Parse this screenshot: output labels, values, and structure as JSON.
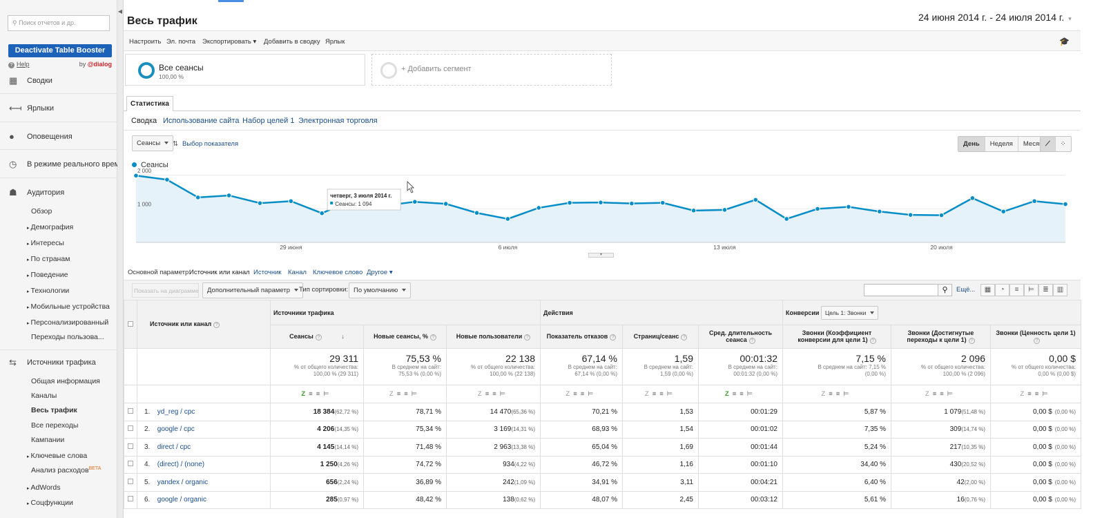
{
  "sidebar": {
    "search_placeholder": "Поиск отчетов и др.",
    "booster": "Deactivate Table Booster",
    "help": "Help",
    "by": "by",
    "brand": "@dialog",
    "nav": [
      {
        "icon": "grid-icon",
        "label": "Сводки"
      },
      {
        "icon": "tag-icon",
        "label": "Ярлыки"
      },
      {
        "icon": "bulb-icon",
        "label": "Оповещения"
      },
      {
        "icon": "clock-icon",
        "label": "В режиме реального врем"
      },
      {
        "icon": "people-icon",
        "label": "Аудитория"
      },
      {
        "icon": "arrows-icon",
        "label": "Источники трафика"
      }
    ],
    "audience_sub": [
      "Обзор",
      "Демография",
      "Интересы",
      "По странам",
      "Поведение",
      "Технологии",
      "Мобильные устройства",
      "Персонализированный",
      "Переходы пользова..."
    ],
    "traffic_sub": [
      "Общая информация",
      "Каналы",
      "Весь трафик",
      "Все переходы",
      "Кампании",
      "Ключевые слова",
      "Анализ расходов",
      "AdWords",
      "Соцфункции"
    ],
    "beta": "BETA"
  },
  "header": {
    "title": "Весь трафик",
    "date": "24 июня 2014 г. - 24 июля 2014 г.",
    "date_arrow": "▾"
  },
  "toolbar": {
    "items": [
      "Настроить",
      "Эл. почта",
      "Экспортировать ▾",
      "Добавить в сводку",
      "Ярлык"
    ],
    "hat": "🎓"
  },
  "segments": {
    "name": "Все сеансы",
    "pct": "100,00 %",
    "add": "+ Добавить сегмент"
  },
  "tabs": {
    "stat": "Статистика",
    "sub": [
      "Сводка",
      "Использование сайта",
      "Набор целей 1",
      "Электронная торговля"
    ]
  },
  "chart_controls": {
    "metric": "Сеансы",
    "pick": "Выбор показателя",
    "periods": [
      "День",
      "Неделя",
      "Месяц"
    ]
  },
  "chart_data": {
    "type": "area",
    "series": [
      {
        "name": "Сеансы",
        "values": [
          1990,
          1870,
          1340,
          1400,
          1170,
          1230,
          870,
          1280,
          1094,
          1210,
          1150,
          880,
          700,
          1030,
          1180,
          1190,
          1160,
          1180,
          950,
          970,
          1270,
          700,
          1000,
          1060,
          920,
          820,
          810,
          1320,
          920,
          1230,
          1140
        ]
      }
    ],
    "x_ticks": [
      "29 июня",
      "6 июля",
      "13 июля",
      "20 июля"
    ],
    "y_ticks": [
      "1 000",
      "2 000"
    ],
    "ylim": [
      0,
      2200
    ],
    "color": "#058dc7",
    "tooltip": {
      "date": "четверг, 3 июля 2014 г.",
      "value": "Сеансы: 1 094"
    }
  },
  "primary": {
    "label": "Основной параметр:",
    "current": "Источник или канал",
    "links": [
      "Источник",
      "Канал",
      "Ключевое слово",
      "Другое ▾"
    ]
  },
  "tablebar": {
    "plot": "Показать на диаграмме",
    "secondary": "Дополнительный параметр",
    "sort_label": "Тип сортировки:",
    "sort": "По умолчанию",
    "more": "Ещё..."
  },
  "table": {
    "groups": [
      "Источники трафика",
      "Действия",
      "Конверсии"
    ],
    "goal": "Цель 1: Звонки",
    "dim": "Источник или канал",
    "cols": [
      "Сеансы",
      "Новые сеансы, %",
      "Новые пользователи",
      "Показатель отказов",
      "Страниц/сеанс",
      "Сред. длительность сеанса",
      "Звонки (Коэффициент конверсии для цели 1)",
      "Звонки (Достигнутые переходы к цели 1)",
      "Звонки (Ценность цели 1)"
    ],
    "totals": [
      {
        "v": "29 311",
        "s1": "% от общего количества:",
        "s2": "100,00 % (29 311)"
      },
      {
        "v": "75,53 %",
        "s1": "В среднем на сайт:",
        "s2": "75,53 % (0,00 %)"
      },
      {
        "v": "22 138",
        "s1": "% от общего количества:",
        "s2": "100,00 % (22 138)"
      },
      {
        "v": "67,14 %",
        "s1": "В среднем на сайт:",
        "s2": "67,14 % (0,00 %)"
      },
      {
        "v": "1,59",
        "s1": "В среднем на сайт:",
        "s2": "1,59 (0,00 %)"
      },
      {
        "v": "00:01:32",
        "s1": "В среднем на сайт:",
        "s2": "00:01:32 (0,00 %)"
      },
      {
        "v": "7,15 %",
        "s1": "В среднем на сайт: 7,15 %",
        "s2": "(0,00 %)"
      },
      {
        "v": "2 096",
        "s1": "% от общего количества:",
        "s2": "100,00 % (2 096)"
      },
      {
        "v": "0,00 $",
        "s1": "% от общего количества:",
        "s2": "0,00 % (0,00 $)"
      }
    ],
    "rows": [
      {
        "n": "1.",
        "src": "yd_reg / cpc",
        "s": "18 384",
        "sp": "(62,72 %)",
        "ns": "78,71 %",
        "nu": "14 470",
        "nup": "(65,36 %)",
        "b": "70,21 %",
        "p": "1,53",
        "d": "00:01:29",
        "cr": "5,87 %",
        "g": "1 079",
        "gp": "(51,48 %)",
        "val": "0,00 $",
        "vp": "(0,00 %)"
      },
      {
        "n": "2.",
        "src": "google / cpc",
        "s": "4 206",
        "sp": "(14,35 %)",
        "ns": "75,34 %",
        "nu": "3 169",
        "nup": "(14,31 %)",
        "b": "68,93 %",
        "p": "1,54",
        "d": "00:01:02",
        "cr": "7,35 %",
        "g": "309",
        "gp": "(14,74 %)",
        "val": "0,00 $",
        "vp": "(0,00 %)"
      },
      {
        "n": "3.",
        "src": "direct / cpc",
        "s": "4 145",
        "sp": "(14,14 %)",
        "ns": "71,48 %",
        "nu": "2 963",
        "nup": "(13,38 %)",
        "b": "65,04 %",
        "p": "1,69",
        "d": "00:01:44",
        "cr": "5,24 %",
        "g": "217",
        "gp": "(10,35 %)",
        "val": "0,00 $",
        "vp": "(0,00 %)"
      },
      {
        "n": "4.",
        "src": "(direct) / (none)",
        "s": "1 250",
        "sp": "(4,26 %)",
        "ns": "74,72 %",
        "nu": "934",
        "nup": "(4,22 %)",
        "b": "46,72 %",
        "p": "1,16",
        "d": "00:01:10",
        "cr": "34,40 %",
        "g": "430",
        "gp": "(20,52 %)",
        "val": "0,00 $",
        "vp": "(0,00 %)"
      },
      {
        "n": "5.",
        "src": "yandex / organic",
        "s": "656",
        "sp": "(2,24 %)",
        "ns": "36,89 %",
        "nu": "242",
        "nup": "(1,09 %)",
        "b": "34,91 %",
        "p": "3,11",
        "d": "00:04:21",
        "cr": "6,40 %",
        "g": "42",
        "gp": "(2,00 %)",
        "val": "0,00 $",
        "vp": "(0,00 %)"
      },
      {
        "n": "6.",
        "src": "google / organic",
        "s": "285",
        "sp": "(0,97 %)",
        "ns": "48,42 %",
        "nu": "138",
        "nup": "(0,62 %)",
        "b": "48,07 %",
        "p": "2,45",
        "d": "00:03:12",
        "cr": "5,61 %",
        "g": "16",
        "gp": "(0,76 %)",
        "val": "0,00 $",
        "vp": "(0,00 %)"
      }
    ]
  }
}
